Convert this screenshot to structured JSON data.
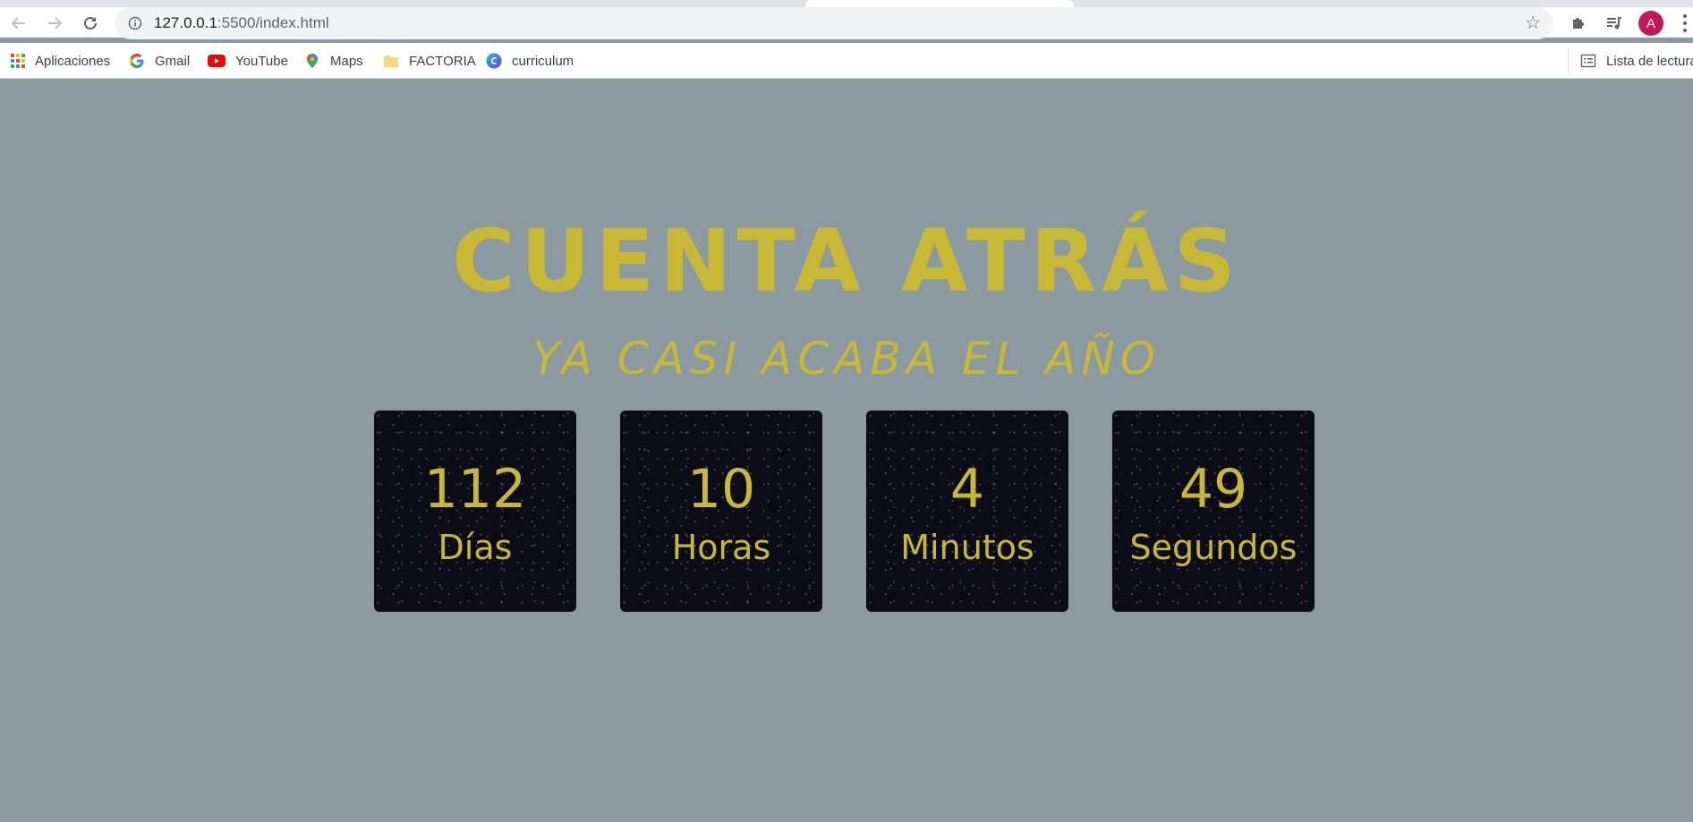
{
  "browser": {
    "url_host": "127.0.0.1",
    "url_path": ":5500/index.html",
    "profile_initial": "A",
    "colors": {
      "avatar": "#c2185b",
      "omnibox": "#f1f3f4"
    }
  },
  "bookmarks": {
    "items": [
      {
        "label": "Aplicaciones",
        "icon": "apps-grid-icon"
      },
      {
        "label": "Gmail",
        "icon": "google-icon"
      },
      {
        "label": "YouTube",
        "icon": "youtube-icon"
      },
      {
        "label": "Maps",
        "icon": "maps-pin-icon"
      },
      {
        "label": "FACTORIA",
        "icon": "folder-icon"
      },
      {
        "label": "curriculum",
        "icon": "canva-icon"
      }
    ],
    "reading_list": "Lista de lectura"
  },
  "page": {
    "title": "CUENTA ATRÁS",
    "subtitle": "YA CASI ACABA EL AÑO",
    "colors": {
      "background": "#8b9aa1",
      "accent": "#c8b834",
      "box": "#0c0c16"
    },
    "countdown": [
      {
        "value": "112",
        "unit": "Días"
      },
      {
        "value": "10",
        "unit": "Horas"
      },
      {
        "value": "4",
        "unit": "Minutos"
      },
      {
        "value": "49",
        "unit": "Segundos"
      }
    ]
  }
}
